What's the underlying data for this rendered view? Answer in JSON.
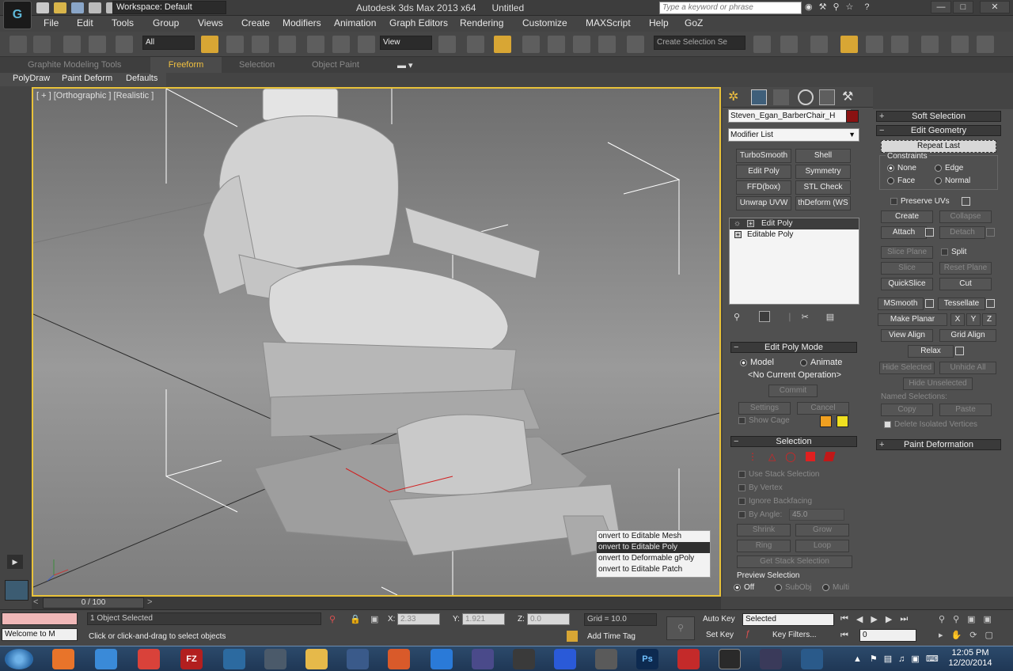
{
  "app": {
    "logo_text": "G",
    "workspace": "Workspace: Default",
    "title": "Autodesk 3ds Max  2013 x64",
    "doc_name": "Untitled",
    "search_placeholder": "Type a keyword or phrase"
  },
  "menubar": [
    "File",
    "Edit",
    "Tools",
    "Group",
    "Views",
    "Create",
    "Modifiers",
    "Animation",
    "Graph Editors",
    "Rendering",
    "Customize",
    "MAXScript",
    "Help",
    "GoZ"
  ],
  "toolbar": {
    "filter_value": "All",
    "refcoord_value": "View",
    "selection_set_placeholder": "Create Selection Se"
  },
  "ribbon": {
    "tabs": [
      "Graphite Modeling Tools",
      "Freeform",
      "Selection",
      "Object Paint"
    ],
    "active_tab": "Freeform",
    "subtabs": [
      "PolyDraw",
      "Paint Deform",
      "Defaults"
    ]
  },
  "viewport": {
    "label": "[ + ] [Orthographic ] [Realistic ]",
    "context_menu": [
      "onvert to Editable Mesh",
      "onvert to Editable Poly",
      "onvert to Deformable gPoly",
      "onvert to Editable Patch"
    ]
  },
  "command_panel": {
    "object_name": "Steven_Egan_BarberChair_H",
    "object_color": "#8a1212",
    "modifier_list": "Modifier List",
    "modifier_buttons": [
      "TurboSmooth",
      "Shell",
      "Edit Poly",
      "Symmetry",
      "FFD(box)",
      "STL Check",
      "Unwrap UVW",
      "thDeform (WS"
    ],
    "stack": [
      "Edit Poly",
      "Editable Poly"
    ],
    "edit_poly_mode": {
      "title": "Edit Poly Mode",
      "model": "Model",
      "animate": "Animate",
      "current_op": "<No Current Operation>",
      "commit": "Commit",
      "settings": "Settings",
      "cancel": "Cancel",
      "show_cage": "Show Cage",
      "cage_colors": [
        "#f0a020",
        "#f0e020"
      ]
    },
    "selection": {
      "title": "Selection",
      "use_stack": "Use Stack Selection",
      "by_vertex": "By Vertex",
      "ignore_backfacing": "Ignore Backfacing",
      "by_angle": "By Angle:",
      "angle_value": "45.0",
      "shrink": "Shrink",
      "grow": "Grow",
      "ring": "Ring",
      "loop": "Loop",
      "get_stack": "Get Stack Selection",
      "preview": "Preview Selection",
      "off": "Off",
      "subobj": "SubObj",
      "multi": "Multi"
    }
  },
  "right_panel": {
    "soft_selection": "Soft Selection",
    "edit_geometry": "Edit Geometry",
    "repeat_last": "Repeat Last",
    "constraints": "Constraints",
    "none": "None",
    "edge": "Edge",
    "face": "Face",
    "normal": "Normal",
    "preserve_uvs": "Preserve UVs",
    "create": "Create",
    "collapse": "Collapse",
    "attach": "Attach",
    "detach": "Detach",
    "slice_plane": "Slice Plane",
    "split": "Split",
    "slice": "Slice",
    "reset_plane": "Reset Plane",
    "quickslice": "QuickSlice",
    "cut": "Cut",
    "msmooth": "MSmooth",
    "tessellate": "Tessellate",
    "make_planar": "Make Planar",
    "x": "X",
    "y": "Y",
    "z": "Z",
    "view_align": "View Align",
    "grid_align": "Grid Align",
    "relax": "Relax",
    "hide_selected": "Hide Selected",
    "unhide_all": "Unhide All",
    "hide_unselected": "Hide Unselected",
    "named_selections": "Named Selections:",
    "copy": "Copy",
    "paste": "Paste",
    "delete_isolated": "Delete Isolated Vertices",
    "paint_deformation": "Paint Deformation"
  },
  "status": {
    "timeline": "0 / 100",
    "objects_selected": "1 Object Selected",
    "prompt": "Click or click-and-drag to select objects",
    "welcome": "Welcome to M",
    "x_label": "X:",
    "x_value": "2.33",
    "y_label": "Y:",
    "y_value": "1.921",
    "z_label": "Z:",
    "z_value": "0.0",
    "grid": "Grid = 10.0",
    "add_time_tag": "Add Time Tag",
    "auto_key": "Auto Key",
    "set_key": "Set Key",
    "key_mode": "Selected",
    "key_filters": "Key Filters...",
    "frame": "0"
  },
  "taskbar": {
    "time": "12:05 PM",
    "date": "12/20/2014"
  }
}
